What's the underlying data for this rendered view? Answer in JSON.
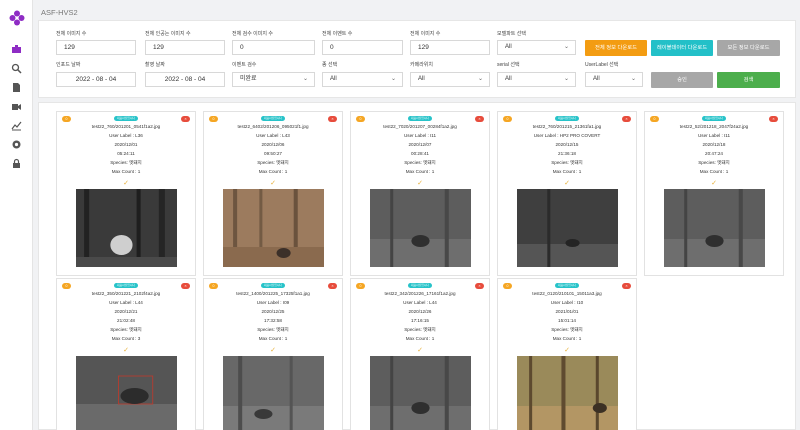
{
  "app": {
    "title": "ASF-HVS2"
  },
  "sidebar": {
    "items": [
      {
        "name": "camera-icon",
        "active": true
      },
      {
        "name": "search-icon",
        "active": false
      },
      {
        "name": "document-icon",
        "active": false
      },
      {
        "name": "video-icon",
        "active": false
      },
      {
        "name": "chart-icon",
        "active": false
      },
      {
        "name": "gear-icon",
        "active": false
      },
      {
        "name": "lock-icon",
        "active": false
      }
    ]
  },
  "filters": {
    "total_images": {
      "label": "전체 이미지 수",
      "value": "129"
    },
    "total_inference_images": {
      "label": "전체 인공는 이미지 수",
      "value": "129"
    },
    "total_reviewed_images": {
      "label": "전체 검수 이미지 수",
      "value": "0"
    },
    "total_events": {
      "label": "전체 이벤트 수",
      "value": "0"
    },
    "total_images_2": {
      "label": "전체 이미지 수",
      "value": "129"
    },
    "model_select": {
      "label": "모델파트 선택",
      "value": "All"
    },
    "start_date": {
      "label": "인포드 날짜",
      "value": "2022 - 08 - 04"
    },
    "capture_date": {
      "label": "촬영 날짜",
      "value": "2022 - 08 - 04"
    },
    "event_review": {
      "label": "이벤트 검수",
      "value": "미완료"
    },
    "species_select": {
      "label": "종 선택",
      "value": "All"
    },
    "camera_select": {
      "label": "카메라위치",
      "value": "All"
    },
    "serial_select": {
      "label": "serial 선택",
      "value": "All"
    },
    "userlabel_select": {
      "label": "UserLabel 선택",
      "value": "All"
    }
  },
  "buttons": {
    "download_all": "전체 정보 다운로드",
    "download_label": "레이블데이터 다운로드",
    "download_full": "모든 정보 다운로드",
    "cancel": "승인",
    "search": "검색"
  },
  "colors": {
    "orange": "#f39c12",
    "teal": "#23c0c8",
    "gray": "#a7a7a7",
    "green": "#4cae4c",
    "accent": "#8e2cc4"
  },
  "cards": [
    {
      "tag": "대표사진입니다",
      "left_badge": "0",
      "right_badge": "×",
      "filename": "test22_760/201201_0541f1a2.jpg",
      "user_label": "User Label : L36",
      "date": "2020/12/01",
      "time": "05:24:11",
      "species": "Species: 멧돼지",
      "max_count": "Max Count : 1",
      "scene": "forest-night"
    },
    {
      "tag": "대표사진입니다",
      "left_badge": "0",
      "right_badge": "×",
      "filename": "test22_6402/201206_095021f1.jpg",
      "user_label": "User Label : L43",
      "date": "2020/12/06",
      "time": "09:50:27",
      "species": "Species: 멧돼지",
      "max_count": "Max Count : 1",
      "scene": "forest-day"
    },
    {
      "tag": "대표사진입니다",
      "left_badge": "0",
      "right_badge": "×",
      "filename": "test22_7020/201207_00284f1a2.jpg",
      "user_label": "User Label : I11",
      "date": "2020/12/07",
      "time": "00:28:41",
      "species": "Species: 멧돼지",
      "max_count": "Max Count : 1",
      "scene": "night-gray"
    },
    {
      "tag": "대표사진입니다",
      "left_badge": "0",
      "right_badge": "×",
      "filename": "test22_760/201215_21361fa1.jpg",
      "user_label": "User Label : HP2 PRO COVERT",
      "date": "2020/12/15",
      "time": "21:36:18",
      "species": "Species: 멧돼지",
      "max_count": "Max Count : 1",
      "scene": "night-dark"
    },
    {
      "tag": "대표사진입니다",
      "left_badge": "0",
      "right_badge": "×",
      "filename": "test22_52/201218_2047f24a2.jpg",
      "user_label": "User Label : I11",
      "date": "2020/12/18",
      "time": "20:47:24",
      "species": "Species: 멧돼지",
      "max_count": "Max Count : 1",
      "scene": "night-gray"
    },
    {
      "tag": "대표사진입니다",
      "left_badge": "0",
      "right_badge": "×",
      "filename": "test22_350/201221_2102f4a2.jpg",
      "user_label": "User Label : L44",
      "date": "2020/12/21",
      "time": "21:02:48",
      "species": "Species: 멧돼지",
      "max_count": "Max Count : 3",
      "scene": "night-boar"
    },
    {
      "tag": "대표사진입니다",
      "left_badge": "0",
      "right_badge": "×",
      "filename": "test22_1400/201225_17325f1a1.jpg",
      "user_label": "User Label : I09",
      "date": "2020/12/25",
      "time": "17:32:58",
      "species": "Species: 멧돼지",
      "max_count": "Max Count : 1",
      "scene": "day-gray"
    },
    {
      "tag": "대표사진입니다",
      "left_badge": "0",
      "right_badge": "×",
      "filename": "test22_342/201226_17161f1a2.jpg",
      "user_label": "User Label : L44",
      "date": "2020/12/26",
      "time": "17:16:15",
      "species": "Species: 멧돼지",
      "max_count": "Max Count : 1",
      "scene": "night-gray"
    },
    {
      "tag": "대표사진입니다",
      "left_badge": "0",
      "right_badge": "×",
      "filename": "test22_0120/210101_15011a3.jpg",
      "user_label": "User Label : I10",
      "date": "2021/01/01",
      "time": "15:01:14",
      "species": "Species: 멧돼지",
      "max_count": "Max Count : 1",
      "scene": "forest-day-2"
    }
  ]
}
